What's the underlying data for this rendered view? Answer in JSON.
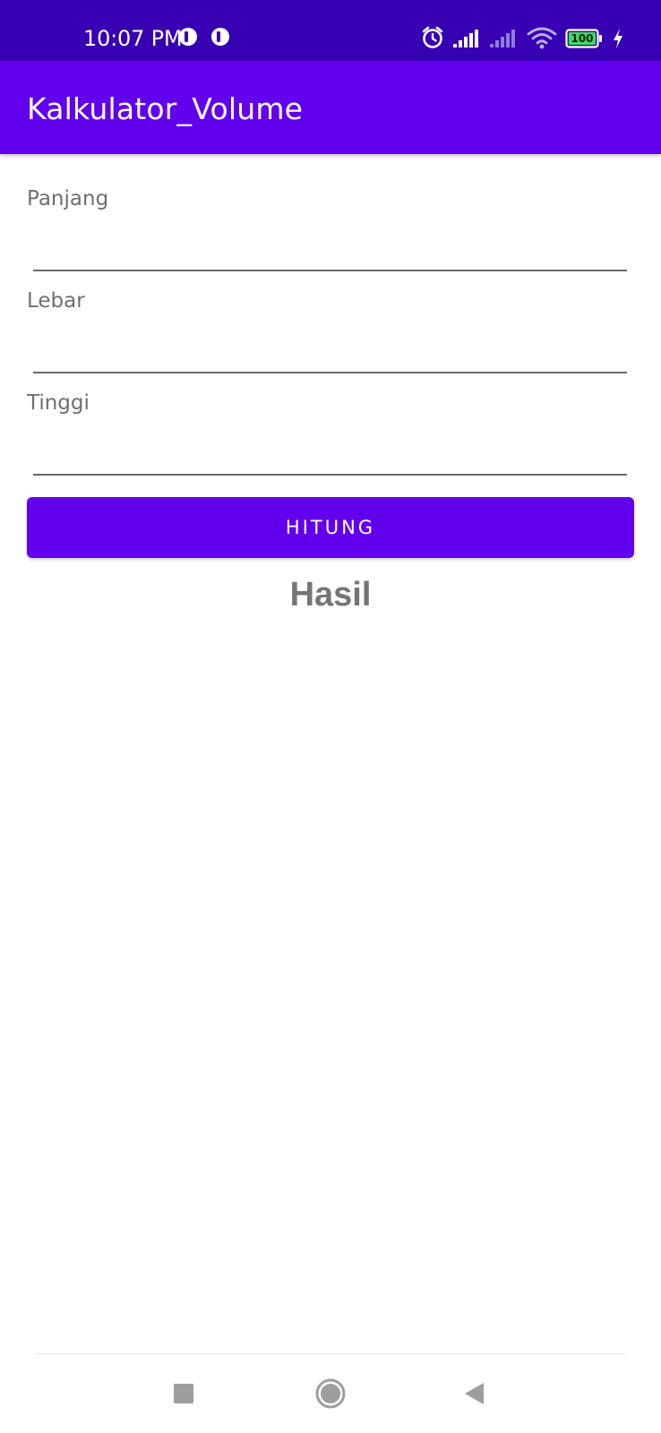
{
  "status_bar": {
    "time": "10:07 PM",
    "battery_level": "100"
  },
  "app_bar": {
    "title": "Kalkulator_Volume"
  },
  "form": {
    "fields": [
      {
        "label": "Panjang",
        "value": ""
      },
      {
        "label": "Lebar",
        "value": ""
      },
      {
        "label": "Tinggi",
        "value": ""
      }
    ],
    "button_label": "HITUNG",
    "result_label": "Hasil"
  },
  "navigation": {
    "items": [
      "recent-apps",
      "home",
      "back"
    ]
  },
  "colors": {
    "status_bar": "#3700b3",
    "primary": "#6200ee",
    "label_gray": "#6f6f6f",
    "result_gray": "#757575"
  }
}
